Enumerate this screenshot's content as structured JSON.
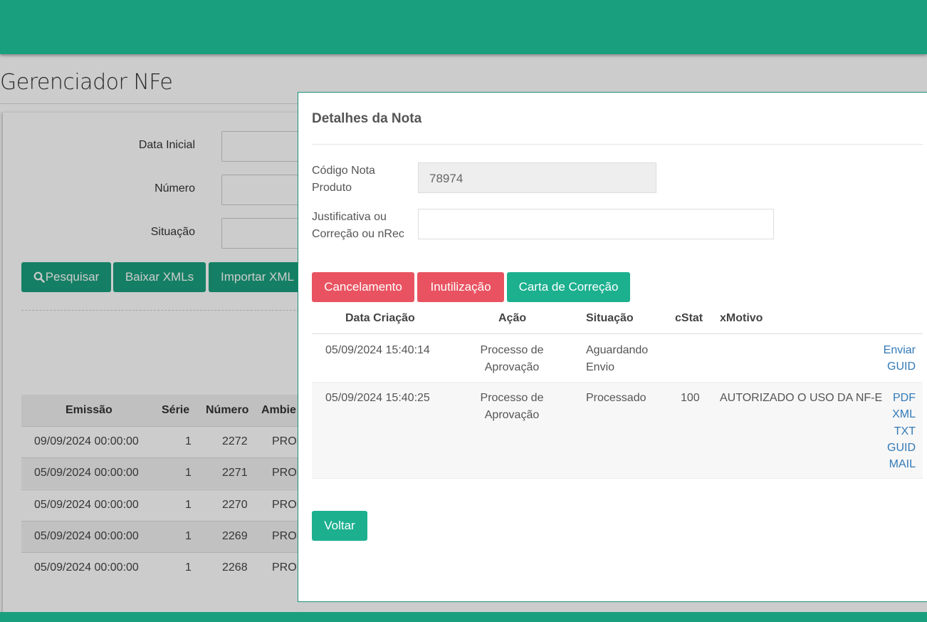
{
  "page": {
    "title": "Gerenciador NFe"
  },
  "filters": {
    "data_inicial_label": "Data Inicial",
    "numero_label": "Número",
    "situacao_label": "Situação"
  },
  "actions": {
    "pesquisar": "Pesquisar",
    "baixar": "Baixar XMLs",
    "importar": "Importar XML"
  },
  "grid": {
    "headers": [
      "Emissão",
      "Série",
      "Número",
      "Ambie"
    ],
    "rows": [
      {
        "emissao": "09/09/2024 00:00:00",
        "serie": "1",
        "numero": "2272",
        "ambiente": "PROD"
      },
      {
        "emissao": "05/09/2024 00:00:00",
        "serie": "1",
        "numero": "2271",
        "ambiente": "PROD"
      },
      {
        "emissao": "05/09/2024 00:00:00",
        "serie": "1",
        "numero": "2270",
        "ambiente": "PROD"
      },
      {
        "emissao": "05/09/2024 00:00:00",
        "serie": "1",
        "numero": "2269",
        "ambiente": "PROD"
      },
      {
        "emissao": "05/09/2024 00:00:00",
        "serie": "1",
        "numero": "2268",
        "ambiente": "PROD"
      }
    ]
  },
  "modal": {
    "title": "Detalhes da Nota",
    "codigo_label": "Código Nota Produto",
    "codigo_value": "78974",
    "justificativa_label": "Justificativa ou Correção ou nRec",
    "justificativa_value": "",
    "buttons": {
      "cancelamento": "Cancelamento",
      "inutilizacao": "Inutilização",
      "carta": "Carta de Correção",
      "voltar": "Voltar"
    },
    "table": {
      "headers": {
        "data": "Data Criação",
        "acao": "Ação",
        "situacao": "Situação",
        "cstat": "cStat",
        "xmotivo": "xMotivo"
      },
      "rows": [
        {
          "data": "05/09/2024 15:40:14",
          "acao_1": "Processo de",
          "acao_2": "Aprovação",
          "situacao_1": "Aguardando",
          "situacao_2": "Envio",
          "cstat": "",
          "xmotivo": "",
          "links": [
            "Enviar",
            "GUID"
          ]
        },
        {
          "data": "05/09/2024 15:40:25",
          "acao_1": "Processo de",
          "acao_2": "Aprovação",
          "situacao_1": "Processado",
          "situacao_2": "",
          "cstat": "100",
          "xmotivo": "AUTORIZADO O USO DA NF-E",
          "links": [
            "PDF",
            "XML",
            "TXT",
            "GUID",
            "MAIL"
          ]
        }
      ]
    }
  },
  "colors": {
    "brand": "#1a9f7e",
    "danger": "#e95361",
    "link": "#337ab7"
  }
}
